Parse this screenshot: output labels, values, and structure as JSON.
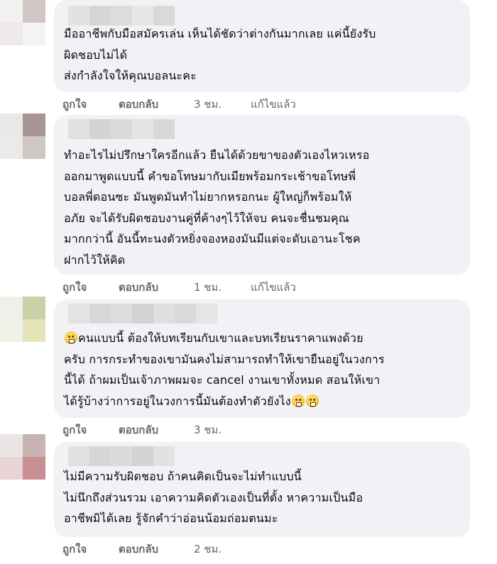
{
  "comments": [
    {
      "text": "มืออาชีพกับมือสมัครเล่น เห็นได้ชัดว่าต่างกันมากเลย แค่นี้ยังรับ\nผิดชอบไม่ได้\nส่งกำลังใจให้คุณบอลนะคะ",
      "like": "ถูกใจ",
      "reply": "ตอบกลับ",
      "time": "3 ชม.",
      "edited": "แก้ไขแล้ว"
    },
    {
      "text": "ทำอะไรไม่ปรึกษาใครอีกแล้ว ยืนได้ด้วยขาของตัวเองไหวเหรอ\nออกมาพูดแบบนี้ คำขอโทษมากับเมียพร้อมกระเช้าขอโทษพี่\nบอลพี่ดอนซะ มันพูดมันทำไม่ยากหรอกนะ ผู้ใหญ่ก็พร้อมให้\nอภัย จะได้รับผิดชอบงานคู่ที่ค้างๆไว้ให้จบ คนจะชื่นชมคุณ\nมากกว่านี้ อันนี้ทะนงตัวหยิ่งจองหองมันมีแต่จะดับเอานะโชค\nฝากไว้ให้คิด",
      "like": "ถูกใจ",
      "reply": "ตอบกลับ",
      "time": "1 ชม.",
      "edited": "แก้ไขแล้ว"
    },
    {
      "line1": "คนแบบนี้ ต้องให้บทเรียนกับเขาและบทเรียนราคาแพงด้วย",
      "line2": "ครับ การกระทำของเขามันคงไม่สามารถทำให้เขายืนอยู่ในวงการ",
      "line3": "นี้ได้ ถ้าผมเป็นเจ้าภาพผมจะ cancel งานเขาทั้งหมด สอนให้เขา",
      "line4": "ได้รู้บ้างว่าการอยู่ในวงการนี้มันต้องทำตัวยังไง",
      "emoji": "shocked-face",
      "like": "ถูกใจ",
      "reply": "ตอบกลับ",
      "time": "3 ชม."
    },
    {
      "text": "ไม่มีความรับผิดชอบ ถ้าคนคิดเป็นจะไม่ทำแบบนี้\nไม่นึกถึงส่วนรวม เอาความคิดตัวเองเป็นที่ตั้ง หาความเป็นมือ\nอาชีพมิได้เลย รู้จักคำว่าอ่อนน้อมถ่อมตนมะ",
      "like": "ถูกใจ",
      "reply": "ตอบกลับ",
      "time": "2 ชม."
    }
  ],
  "colors": {
    "bubble": "#f0f2f5",
    "meta": "#65676b"
  }
}
